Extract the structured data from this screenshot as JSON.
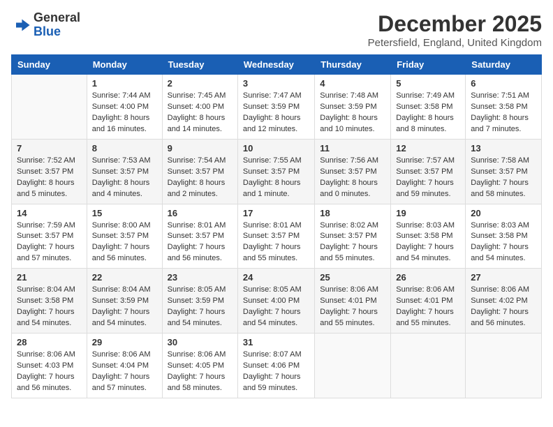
{
  "logo": {
    "general": "General",
    "blue": "Blue"
  },
  "header": {
    "month": "December 2025",
    "location": "Petersfield, England, United Kingdom"
  },
  "days_of_week": [
    "Sunday",
    "Monday",
    "Tuesday",
    "Wednesday",
    "Thursday",
    "Friday",
    "Saturday"
  ],
  "weeks": [
    [
      {
        "day": "",
        "sunrise": "",
        "sunset": "",
        "daylight": "",
        "empty": true
      },
      {
        "day": "1",
        "sunrise": "Sunrise: 7:44 AM",
        "sunset": "Sunset: 4:00 PM",
        "daylight": "Daylight: 8 hours and 16 minutes."
      },
      {
        "day": "2",
        "sunrise": "Sunrise: 7:45 AM",
        "sunset": "Sunset: 4:00 PM",
        "daylight": "Daylight: 8 hours and 14 minutes."
      },
      {
        "day": "3",
        "sunrise": "Sunrise: 7:47 AM",
        "sunset": "Sunset: 3:59 PM",
        "daylight": "Daylight: 8 hours and 12 minutes."
      },
      {
        "day": "4",
        "sunrise": "Sunrise: 7:48 AM",
        "sunset": "Sunset: 3:59 PM",
        "daylight": "Daylight: 8 hours and 10 minutes."
      },
      {
        "day": "5",
        "sunrise": "Sunrise: 7:49 AM",
        "sunset": "Sunset: 3:58 PM",
        "daylight": "Daylight: 8 hours and 8 minutes."
      },
      {
        "day": "6",
        "sunrise": "Sunrise: 7:51 AM",
        "sunset": "Sunset: 3:58 PM",
        "daylight": "Daylight: 8 hours and 7 minutes."
      }
    ],
    [
      {
        "day": "7",
        "sunrise": "Sunrise: 7:52 AM",
        "sunset": "Sunset: 3:57 PM",
        "daylight": "Daylight: 8 hours and 5 minutes."
      },
      {
        "day": "8",
        "sunrise": "Sunrise: 7:53 AM",
        "sunset": "Sunset: 3:57 PM",
        "daylight": "Daylight: 8 hours and 4 minutes."
      },
      {
        "day": "9",
        "sunrise": "Sunrise: 7:54 AM",
        "sunset": "Sunset: 3:57 PM",
        "daylight": "Daylight: 8 hours and 2 minutes."
      },
      {
        "day": "10",
        "sunrise": "Sunrise: 7:55 AM",
        "sunset": "Sunset: 3:57 PM",
        "daylight": "Daylight: 8 hours and 1 minute."
      },
      {
        "day": "11",
        "sunrise": "Sunrise: 7:56 AM",
        "sunset": "Sunset: 3:57 PM",
        "daylight": "Daylight: 8 hours and 0 minutes."
      },
      {
        "day": "12",
        "sunrise": "Sunrise: 7:57 AM",
        "sunset": "Sunset: 3:57 PM",
        "daylight": "Daylight: 7 hours and 59 minutes."
      },
      {
        "day": "13",
        "sunrise": "Sunrise: 7:58 AM",
        "sunset": "Sunset: 3:57 PM",
        "daylight": "Daylight: 7 hours and 58 minutes."
      }
    ],
    [
      {
        "day": "14",
        "sunrise": "Sunrise: 7:59 AM",
        "sunset": "Sunset: 3:57 PM",
        "daylight": "Daylight: 7 hours and 57 minutes."
      },
      {
        "day": "15",
        "sunrise": "Sunrise: 8:00 AM",
        "sunset": "Sunset: 3:57 PM",
        "daylight": "Daylight: 7 hours and 56 minutes."
      },
      {
        "day": "16",
        "sunrise": "Sunrise: 8:01 AM",
        "sunset": "Sunset: 3:57 PM",
        "daylight": "Daylight: 7 hours and 56 minutes."
      },
      {
        "day": "17",
        "sunrise": "Sunrise: 8:01 AM",
        "sunset": "Sunset: 3:57 PM",
        "daylight": "Daylight: 7 hours and 55 minutes."
      },
      {
        "day": "18",
        "sunrise": "Sunrise: 8:02 AM",
        "sunset": "Sunset: 3:57 PM",
        "daylight": "Daylight: 7 hours and 55 minutes."
      },
      {
        "day": "19",
        "sunrise": "Sunrise: 8:03 AM",
        "sunset": "Sunset: 3:58 PM",
        "daylight": "Daylight: 7 hours and 54 minutes."
      },
      {
        "day": "20",
        "sunrise": "Sunrise: 8:03 AM",
        "sunset": "Sunset: 3:58 PM",
        "daylight": "Daylight: 7 hours and 54 minutes."
      }
    ],
    [
      {
        "day": "21",
        "sunrise": "Sunrise: 8:04 AM",
        "sunset": "Sunset: 3:58 PM",
        "daylight": "Daylight: 7 hours and 54 minutes."
      },
      {
        "day": "22",
        "sunrise": "Sunrise: 8:04 AM",
        "sunset": "Sunset: 3:59 PM",
        "daylight": "Daylight: 7 hours and 54 minutes."
      },
      {
        "day": "23",
        "sunrise": "Sunrise: 8:05 AM",
        "sunset": "Sunset: 3:59 PM",
        "daylight": "Daylight: 7 hours and 54 minutes."
      },
      {
        "day": "24",
        "sunrise": "Sunrise: 8:05 AM",
        "sunset": "Sunset: 4:00 PM",
        "daylight": "Daylight: 7 hours and 54 minutes."
      },
      {
        "day": "25",
        "sunrise": "Sunrise: 8:06 AM",
        "sunset": "Sunset: 4:01 PM",
        "daylight": "Daylight: 7 hours and 55 minutes."
      },
      {
        "day": "26",
        "sunrise": "Sunrise: 8:06 AM",
        "sunset": "Sunset: 4:01 PM",
        "daylight": "Daylight: 7 hours and 55 minutes."
      },
      {
        "day": "27",
        "sunrise": "Sunrise: 8:06 AM",
        "sunset": "Sunset: 4:02 PM",
        "daylight": "Daylight: 7 hours and 56 minutes."
      }
    ],
    [
      {
        "day": "28",
        "sunrise": "Sunrise: 8:06 AM",
        "sunset": "Sunset: 4:03 PM",
        "daylight": "Daylight: 7 hours and 56 minutes."
      },
      {
        "day": "29",
        "sunrise": "Sunrise: 8:06 AM",
        "sunset": "Sunset: 4:04 PM",
        "daylight": "Daylight: 7 hours and 57 minutes."
      },
      {
        "day": "30",
        "sunrise": "Sunrise: 8:06 AM",
        "sunset": "Sunset: 4:05 PM",
        "daylight": "Daylight: 7 hours and 58 minutes."
      },
      {
        "day": "31",
        "sunrise": "Sunrise: 8:07 AM",
        "sunset": "Sunset: 4:06 PM",
        "daylight": "Daylight: 7 hours and 59 minutes."
      },
      {
        "day": "",
        "empty": true
      },
      {
        "day": "",
        "empty": true
      },
      {
        "day": "",
        "empty": true
      }
    ]
  ]
}
